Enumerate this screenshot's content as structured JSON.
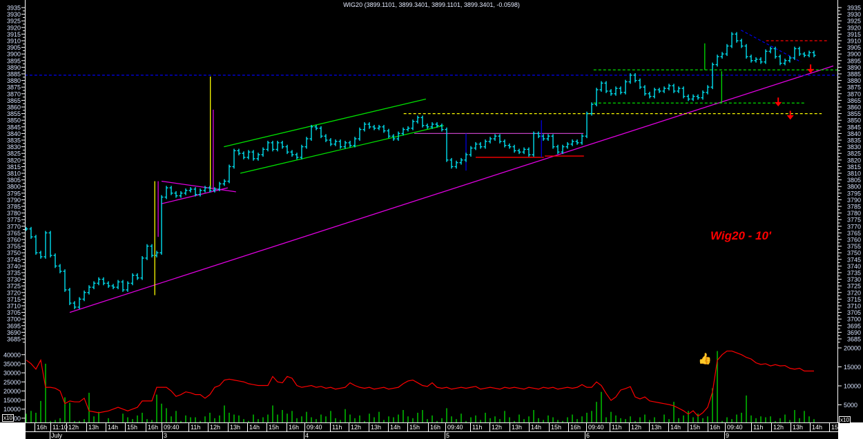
{
  "header": {
    "title": "WIG20 (3899.1101, 3899.3401, 3899.1101, 3899.3401, -0.0598)"
  },
  "annotation_label": "Wig20 - 10'",
  "volume_scale_label": "x10",
  "icons": {
    "thumbs_up": "thumbs-up-icon",
    "arrow_down": "arrow-down-icon"
  },
  "colors": {
    "bars": "#00e0f0",
    "volume": "#00e000",
    "indicator": "#ff0000",
    "trend": "#e000e0",
    "channel": "#00e000",
    "level_yellow": "#ffff00",
    "level_blue": "#0000e0",
    "level_red": "#ff0000",
    "text": "#d8e4ff"
  },
  "chart_data": {
    "type": "ohlc",
    "title": "WIG20 (3899.1101, 3899.3401, 3899.1101, 3899.3401, -0.0598)",
    "price_axis": {
      "min": 3685,
      "max": 3935,
      "step": 5
    },
    "volume_axis_left": {
      "ticks": [
        5000,
        10000,
        15000,
        20000,
        25000,
        30000,
        35000,
        40000
      ]
    },
    "volume_axis_right": {
      "ticks": [
        5000,
        10000,
        15000,
        20000
      ]
    },
    "time_labels": [
      "16h",
      "11:10",
      "12h",
      "13h",
      "14h",
      "15h",
      "16h",
      "09:40",
      "11h",
      "12h",
      "13h",
      "14h",
      "15h",
      "16h",
      "09:40",
      "11h",
      "12h",
      "13h",
      "14h",
      "15h",
      "16h",
      "09:40",
      "11h",
      "12h",
      "13h",
      "14h",
      "15h",
      "16h",
      "09:40",
      "11h",
      "12h",
      "13h",
      "14h",
      "15h",
      "16h",
      "09:40",
      "11h",
      "12h",
      "13h",
      "14h",
      "15"
    ],
    "date_labels": [
      "July",
      "3",
      "4",
      "5",
      "6",
      "9"
    ],
    "close": [
      3768,
      3762,
      3750,
      3747,
      3765,
      3748,
      3740,
      3736,
      3722,
      3712,
      3709,
      3715,
      3720,
      3724,
      3727,
      3730,
      3727,
      3725,
      3724,
      3728,
      3722,
      3727,
      3733,
      3731,
      3746,
      3755,
      3748,
      3750,
      3792,
      3799,
      3795,
      3793,
      3795,
      3797,
      3798,
      3794,
      3797,
      3799,
      3797,
      3798,
      3802,
      3804,
      3815,
      3827,
      3825,
      3822,
      3826,
      3821,
      3824,
      3828,
      3833,
      3828,
      3833,
      3830,
      3826,
      3824,
      3822,
      3830,
      3836,
      3845,
      3844,
      3838,
      3835,
      3832,
      3834,
      3830,
      3833,
      3831,
      3836,
      3843,
      3847,
      3845,
      3844,
      3845,
      3842,
      3838,
      3836,
      3840,
      3843,
      3844,
      3849,
      3852,
      3846,
      3845,
      3847,
      3846,
      3843,
      3820,
      3815,
      3818,
      3820,
      3824,
      3829,
      3832,
      3830,
      3834,
      3836,
      3838,
      3834,
      3831,
      3830,
      3827,
      3826,
      3828,
      3824,
      3840,
      3838,
      3836,
      3838,
      3830,
      3826,
      3830,
      3832,
      3834,
      3833,
      3838,
      3855,
      3862,
      3873,
      3878,
      3872,
      3870,
      3874,
      3871,
      3879,
      3884,
      3880,
      3875,
      3870,
      3868,
      3873,
      3872,
      3874,
      3876,
      3872,
      3874,
      3868,
      3866,
      3868,
      3867,
      3871,
      3875,
      3892,
      3898,
      3900,
      3906,
      3915,
      3910,
      3906,
      3898,
      3895,
      3896,
      3894,
      3902,
      3904,
      3898,
      3893,
      3895,
      3897,
      3904,
      3900,
      3899,
      3901,
      3899
    ],
    "volume": [
      7500,
      9000,
      8000,
      14500,
      35000,
      3500,
      4000,
      5000,
      16500,
      13500,
      3500,
      3500,
      4500,
      19000,
      6000,
      8500,
      2500,
      5000,
      3000,
      2500,
      7500,
      5500,
      4500,
      6500,
      8000,
      4500,
      4000,
      18000,
      13000,
      10500,
      6000,
      9000,
      3500,
      6500,
      5500,
      5500,
      3500,
      6000,
      8000,
      5000,
      6500,
      12000,
      8000,
      7000,
      6500,
      4500,
      3500,
      7000,
      4500,
      5500,
      7000,
      12000,
      7000,
      9500,
      7500,
      9000,
      5000,
      6000,
      8500,
      5500,
      4500,
      7000,
      6000,
      9000,
      5000,
      4000,
      10000,
      7000,
      5000,
      6500,
      3500,
      7500,
      5500,
      8500,
      4000,
      6000,
      5500,
      7000,
      9500,
      6000,
      5000,
      8000,
      9500,
      4500,
      6500,
      3500,
      5000,
      10500,
      6000,
      4500,
      7500,
      3500,
      5500,
      6500,
      4000,
      8000,
      5000,
      6000,
      4500,
      9000,
      5500,
      3500,
      7000,
      4500,
      6000,
      9500,
      5000,
      4000,
      6500,
      5500,
      4000,
      3500,
      5500,
      7000,
      4500,
      6000,
      8000,
      9000,
      14000,
      19500,
      5500,
      8500,
      6500,
      5000,
      4500,
      6000,
      3500,
      5500,
      7000,
      4000,
      5500,
      3000,
      7000,
      4500,
      14000,
      5000,
      6500,
      9000,
      5500,
      7500,
      5000,
      6000,
      21500,
      42000,
      3500,
      5500,
      4500,
      7000,
      8000,
      17500,
      6500,
      5000,
      6000,
      5500,
      6000,
      3500,
      5000,
      7000,
      4000,
      9500,
      5000,
      9000,
      6000,
      4500
    ],
    "indicator": [
      37000,
      35000,
      32000,
      37000,
      22000,
      22000,
      21500,
      20000,
      13000,
      14500,
      14000,
      14000,
      16000,
      9000,
      8500,
      8000,
      8500,
      9000,
      10000,
      11000,
      10000,
      9000,
      10000,
      11000,
      14500,
      14500,
      14500,
      22000,
      22000,
      22000,
      20000,
      17000,
      18000,
      19500,
      19000,
      18000,
      18000,
      16000,
      18000,
      22000,
      23000,
      26000,
      26500,
      26000,
      25500,
      25000,
      24000,
      23500,
      23000,
      23000,
      23000,
      28000,
      25000,
      24500,
      28000,
      27000,
      23000,
      22000,
      22500,
      23000,
      22000,
      22500,
      21500,
      22000,
      21000,
      21500,
      22000,
      24500,
      23000,
      22000,
      21500,
      22000,
      21000,
      21500,
      22000,
      21000,
      21500,
      22000,
      24000,
      25500,
      26000,
      24500,
      23000,
      22500,
      24500,
      22000,
      21500,
      22000,
      21000,
      21500,
      22000,
      21500,
      22000,
      22500,
      21000,
      21500,
      22000,
      21500,
      21000,
      22000,
      21500,
      22000,
      21500,
      21000,
      22000,
      21500,
      21000,
      22000,
      21500,
      22000,
      21000,
      21500,
      22000,
      21500,
      22000,
      23500,
      22000,
      22000,
      25000,
      23000,
      18600,
      14800,
      16700,
      20500,
      21300,
      22400,
      16700,
      15600,
      16700,
      14500,
      14000,
      13500,
      13000,
      12500,
      11800,
      10500,
      9100,
      7200,
      9100,
      6100,
      8000,
      11000,
      19400,
      36900,
      40000,
      42000,
      42000,
      41000,
      40000,
      38500,
      37600,
      35500,
      34600,
      35000,
      33800,
      34500,
      33800,
      34000,
      32500,
      32000,
      32500,
      31000,
      31000,
      31000
    ],
    "drawings": [
      {
        "kind": "trendline",
        "color": "#e000e0",
        "from": [
          9,
          3705
        ],
        "to": [
          167,
          3891
        ]
      },
      {
        "kind": "triangle-upper",
        "color": "#e000e0",
        "from": [
          28,
          3804
        ],
        "to": [
          43.4,
          3796
        ]
      },
      {
        "kind": "triangle-lower",
        "color": "#e000e0",
        "from": [
          28,
          3787
        ],
        "to": [
          41.7,
          3799
        ]
      },
      {
        "kind": "channel-upper",
        "color": "#00e000",
        "from": [
          40.9,
          3830
        ],
        "to": [
          82.7,
          3866
        ]
      },
      {
        "kind": "channel-lower",
        "color": "#00e000",
        "from": [
          44.3,
          3810
        ],
        "to": [
          86.4,
          3846
        ]
      },
      {
        "kind": "level",
        "color": "#ffff00",
        "dash": true,
        "from": [
          78.1,
          3855
        ],
        "to": [
          164.6,
          3855
        ]
      },
      {
        "kind": "range-top",
        "color": "#c040c0",
        "from": [
          80.3,
          3840
        ],
        "to": [
          115.3,
          3840
        ]
      },
      {
        "kind": "range-bottom",
        "color": "#ff0000",
        "from": [
          93,
          3822
        ],
        "to": [
          107.1,
          3822
        ]
      },
      {
        "kind": "range-bottom",
        "color": "#ff0000",
        "from": [
          107.3,
          3823
        ],
        "to": [
          115.4,
          3823
        ]
      },
      {
        "kind": "vertical",
        "color": "#0000e0",
        "from": [
          91,
          3840
        ],
        "to": [
          91,
          3812
        ]
      },
      {
        "kind": "vertical",
        "color": "#0000e0",
        "from": [
          106.6,
          3850
        ],
        "to": [
          106.6,
          3822
        ]
      },
      {
        "kind": "level",
        "color": "#00e000",
        "dash": true,
        "from": [
          117.4,
          3888
        ],
        "to": [
          168.9,
          3888
        ]
      },
      {
        "kind": "level",
        "color": "#00e000",
        "dash": true,
        "from": [
          117.4,
          3863
        ],
        "to": [
          161,
          3863
        ]
      },
      {
        "kind": "level",
        "color": "#0000e0",
        "dash": true,
        "from": [
          -0.3,
          3884
        ],
        "to": [
          168.9,
          3884
        ]
      },
      {
        "kind": "level",
        "color": "#ff0000",
        "dash": true,
        "from": [
          153.1,
          3910
        ],
        "to": [
          166,
          3910
        ]
      },
      {
        "kind": "trendline",
        "color": "#0000e0",
        "dash": true,
        "from": [
          147.9,
          3918
        ],
        "to": [
          160.3,
          3894
        ]
      },
      {
        "kind": "vertical",
        "color": "#ffff00",
        "from": [
          26.6,
          3804
        ],
        "to": [
          26.6,
          3718
        ]
      },
      {
        "kind": "vertical",
        "color": "#e000e0",
        "from": [
          27.3,
          3804
        ],
        "to": [
          27.3,
          3762
        ]
      },
      {
        "kind": "vertical",
        "color": "#ffff00",
        "from": [
          38.1,
          3883
        ],
        "to": [
          38.1,
          3798
        ]
      },
      {
        "kind": "vertical",
        "color": "#e000e0",
        "from": [
          38.7,
          3858
        ],
        "to": [
          38.7,
          3797
        ]
      },
      {
        "kind": "vertical",
        "color": "#00e000",
        "from": [
          140.4,
          3908
        ],
        "to": [
          140.4,
          3888
        ]
      },
      {
        "kind": "vertical",
        "color": "#00e000",
        "from": [
          143.9,
          3887
        ],
        "to": [
          143.9,
          3863
        ]
      }
    ],
    "arrows": [
      [
        162.3,
        3889
      ],
      [
        155.6,
        3864
      ],
      [
        158.1,
        3854
      ]
    ]
  }
}
